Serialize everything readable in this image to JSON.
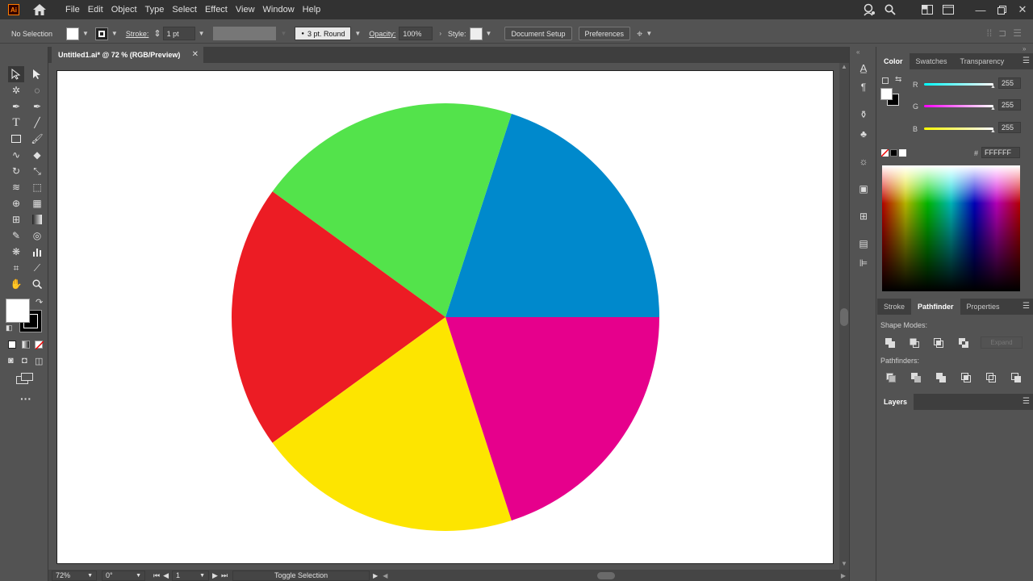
{
  "menubar": {
    "logo": "Ai",
    "items": [
      "File",
      "Edit",
      "Object",
      "Type",
      "Select",
      "Effect",
      "View",
      "Window",
      "Help"
    ]
  },
  "control": {
    "selection": "No Selection",
    "stroke_label": "Stroke:",
    "stroke_value": "1 pt",
    "profile": "3 pt. Round",
    "opacity_label": "Opacity:",
    "opacity_value": "100%",
    "style_label": "Style:",
    "doc_setup": "Document Setup",
    "preferences": "Preferences"
  },
  "document": {
    "tab_title": "Untitled1.ai* @ 72 % (RGB/Preview)"
  },
  "artwork": {
    "slices": [
      {
        "name": "blue",
        "color": "#0089cc",
        "start": 0,
        "end": 72
      },
      {
        "name": "green",
        "color": "#53e34b",
        "start": 72,
        "end": 144
      },
      {
        "name": "red",
        "color": "#ec1c24",
        "start": 144,
        "end": 216
      },
      {
        "name": "yellow",
        "color": "#fde500",
        "start": 216,
        "end": 288
      },
      {
        "name": "magenta",
        "color": "#e6008c",
        "start": 288,
        "end": 360
      }
    ]
  },
  "status": {
    "zoom": "72%",
    "rotation": "0°",
    "artboard": "1",
    "mode": "Toggle Selection"
  },
  "color_panel": {
    "tabs": [
      "Color",
      "Swatches",
      "Transparency"
    ],
    "r_label": "R",
    "r_value": "255",
    "g_label": "G",
    "g_value": "255",
    "b_label": "B",
    "b_value": "255",
    "hex_label": "#",
    "hex_value": "FFFFFF"
  },
  "pathfinder_panel": {
    "tabs": [
      "Stroke",
      "Pathfinder",
      "Properties"
    ],
    "shape_modes": "Shape Modes:",
    "expand": "Expand",
    "pathfinders": "Pathfinders:"
  },
  "layers_panel": {
    "tab": "Layers"
  }
}
